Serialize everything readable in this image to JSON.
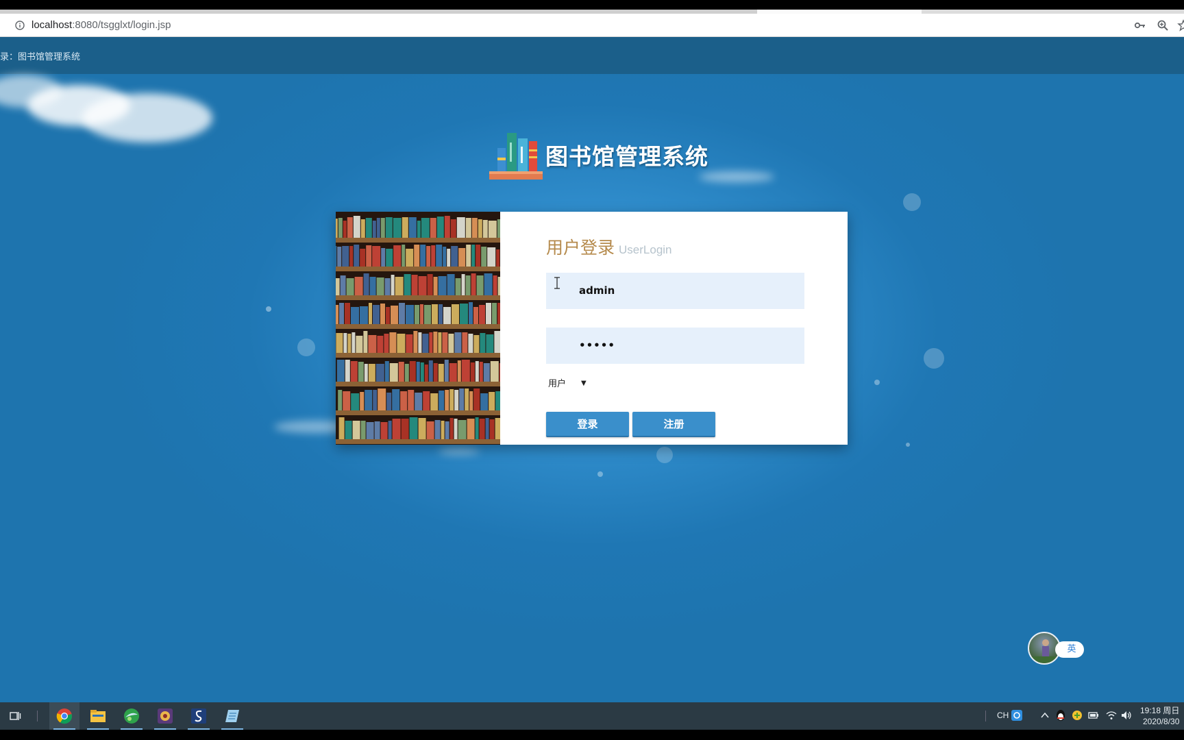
{
  "browser": {
    "url_host": "localhost",
    "url_rest": ":8080/tsgglxt/login.jsp",
    "icons": [
      "info-icon",
      "key-icon",
      "zoom-icon",
      "bookmark-star-icon"
    ]
  },
  "app": {
    "header_text": "录：图书馆管理系统",
    "system_title": "图书馆管理系统"
  },
  "login": {
    "title_cn": "用户登录",
    "title_en": "UserLogin",
    "username_value": "admin",
    "password_value": "•••••",
    "role_selected": "用户",
    "login_label": "登录",
    "register_label": "注册"
  },
  "ime": {
    "mode": "英"
  },
  "taskbar": {
    "apps": [
      "task-view-icon",
      "chrome-icon",
      "file-explorer-icon",
      "app-green-icon",
      "app-game-icon",
      "app-s-icon",
      "notepad-icon"
    ],
    "tray_lang": "CH",
    "time": "19:18 周日",
    "date": "2020/8/30"
  },
  "colors": {
    "background_blue": "#1f77b4",
    "header_blue": "#1b5f8a",
    "accent_gold": "#b58a4c",
    "button_blue": "#3a8fcb",
    "input_bg": "#e6f0fb"
  }
}
